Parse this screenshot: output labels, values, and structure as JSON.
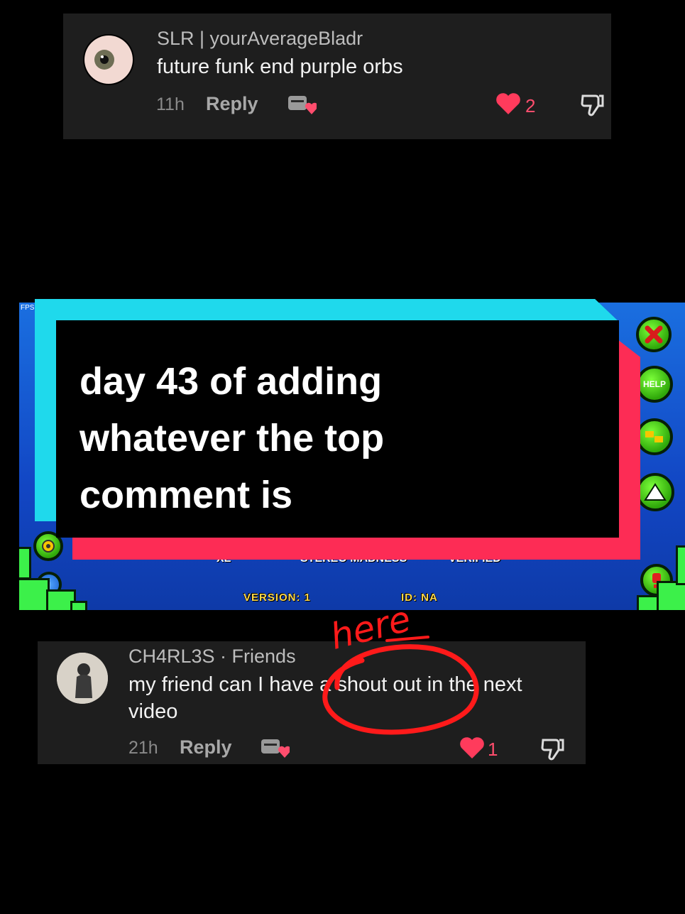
{
  "top_comment": {
    "author": "SLR | yourAverageBladr",
    "text": "future funk end purple orbs",
    "time": "11h",
    "reply_label": "Reply",
    "likes": "2",
    "icons": [
      "eye-avatar",
      "gift-icon",
      "heart-icon",
      "dislike-icon"
    ]
  },
  "game": {
    "fps_label": "FPS:",
    "help_label": "HELP",
    "strip_left": "XL",
    "strip_mid": "STEREO MADNESS",
    "strip_right": "VERIFIED",
    "version_label": "VERSION: 1",
    "id_label": "ID: NA",
    "icons": [
      "close-icon",
      "help-icon",
      "folders-icon",
      "upload-icon",
      "settings-icon",
      "info-icon",
      "report-icon"
    ]
  },
  "caption": {
    "line1": "day 43 of adding",
    "line2": "whatever the top",
    "line3": "comment is"
  },
  "annotation": {
    "word": "here",
    "color": "#ff1a1a"
  },
  "bottom_comment": {
    "author": "CH4RL3S · Friends",
    "text_line1": "my friend can I have a shout out in the next",
    "text_line2": "video",
    "time": "21h",
    "reply_label": "Reply",
    "likes": "1"
  },
  "colors": {
    "cyan": "#1fd9ec",
    "red": "#fd2c55",
    "like": "#ff4d6d"
  }
}
